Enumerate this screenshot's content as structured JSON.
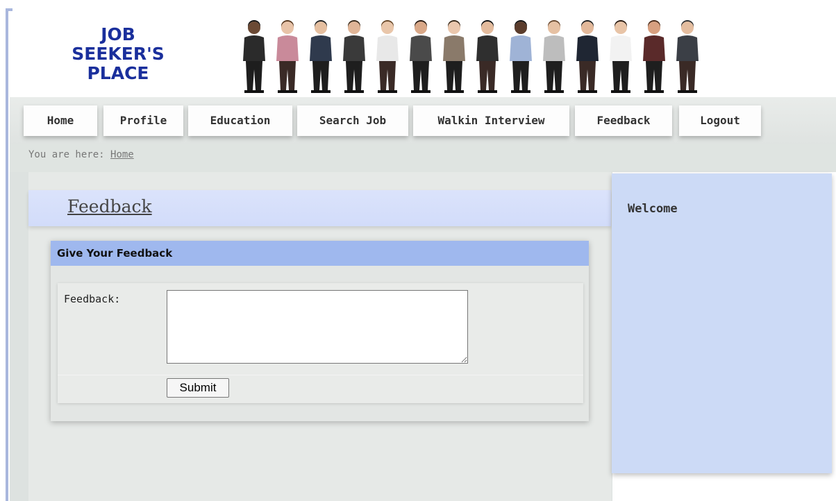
{
  "header": {
    "logo_line1": "JOB",
    "logo_line2": "SEEKER'S",
    "logo_line3": "PLACE"
  },
  "nav": {
    "items": [
      {
        "label": "Home"
      },
      {
        "label": "Profile"
      },
      {
        "label": "Education"
      },
      {
        "label": "Search Job"
      },
      {
        "label": "Walkin Interview"
      },
      {
        "label": "Feedback"
      },
      {
        "label": "Logout"
      }
    ]
  },
  "breadcrumb": {
    "prefix": "You are here:",
    "link": "Home"
  },
  "main": {
    "title": "Feedback",
    "form_heading": "Give Your Feedback",
    "feedback_label": "Feedback:",
    "feedback_value": "",
    "submit_label": "Submit"
  },
  "sidebar": {
    "heading": "Welcome"
  },
  "colors": {
    "logo_text": "#1a2f9c",
    "form_header": "#9fb8ee",
    "title_bar": "#d6dffb",
    "sidebar_bg": "#ccdaf6",
    "page_bg": "#e6e9e7"
  },
  "icons": {
    "banner": "people-banner-image"
  }
}
